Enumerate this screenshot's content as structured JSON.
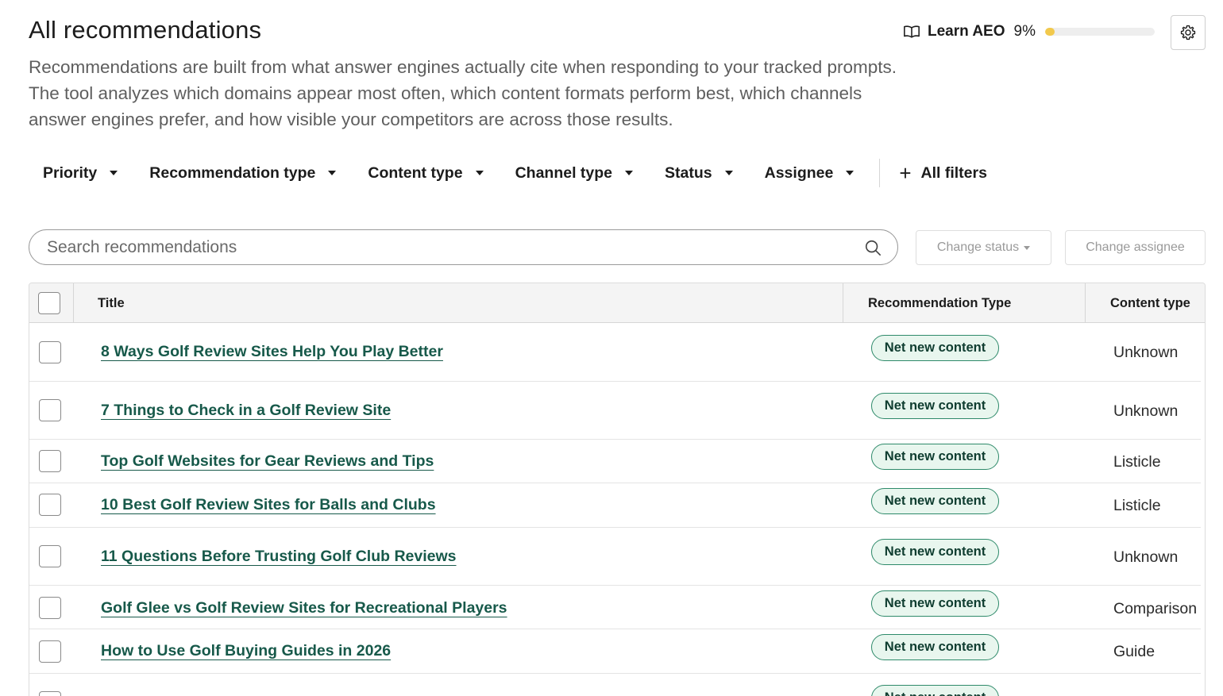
{
  "header": {
    "title": "All recommendations",
    "description": "Recommendations are built from what answer engines actually cite when responding to your tracked prompts. The tool analyzes which domains appear most often, which content formats perform best, which channels answer engines prefer, and how visible your competitors are across those results."
  },
  "learn_aeo": {
    "icon": "book-open-icon",
    "label": "Learn AEO",
    "percent_text": "9%",
    "progress": 0.09,
    "progress_color": "#f2c94c"
  },
  "settings": {
    "icon": "gear-icon"
  },
  "filters": {
    "items": [
      {
        "label": "Priority"
      },
      {
        "label": "Recommendation type"
      },
      {
        "label": "Content type"
      },
      {
        "label": "Channel type"
      },
      {
        "label": "Status"
      },
      {
        "label": "Assignee"
      }
    ],
    "all_filters_label": "All filters"
  },
  "search": {
    "placeholder": "Search recommendations",
    "value": ""
  },
  "actions": {
    "change_status": "Change status",
    "change_assignee": "Change assignee"
  },
  "table": {
    "columns": {
      "title": "Title",
      "recommendation_type": "Recommendation Type",
      "content_type": "Content type"
    },
    "rows": [
      {
        "title": "8 Ways Golf Review Sites Help You Play Better",
        "recommendation_type": "Net new content",
        "content_type": "Unknown"
      },
      {
        "title": "7 Things to Check in a Golf Review Site",
        "recommendation_type": "Net new content",
        "content_type": "Unknown"
      },
      {
        "title": "Top Golf Websites for Gear Reviews and Tips",
        "recommendation_type": "Net new content",
        "content_type": "Listicle"
      },
      {
        "title": "10 Best Golf Review Sites for Balls and Clubs",
        "recommendation_type": "Net new content",
        "content_type": "Listicle"
      },
      {
        "title": "11 Questions Before Trusting Golf Club Reviews",
        "recommendation_type": "Net new content",
        "content_type": "Unknown"
      },
      {
        "title": "Golf Glee vs Golf Review Sites for Recreational Players",
        "recommendation_type": "Net new content",
        "content_type": "Comparison"
      },
      {
        "title": "How to Use Golf Buying Guides in 2026",
        "recommendation_type": "Net new content",
        "content_type": "Guide"
      },
      {
        "title": "",
        "recommendation_type": "Net new content",
        "content_type": ""
      }
    ]
  },
  "colors": {
    "link": "#17594a",
    "pill_border": "#2e8a6a",
    "pill_bg": "#e8f6ee"
  }
}
